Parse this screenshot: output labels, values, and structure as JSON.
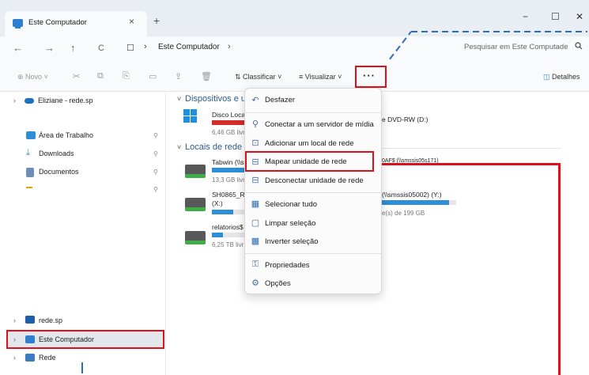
{
  "window": {
    "tab_title": "Este Computador",
    "tab_close": "×",
    "new_tab": "+",
    "minimize": "−",
    "maximize": "☐",
    "close": "✕"
  },
  "address": {
    "back": "←",
    "forward": "→",
    "up": "↑",
    "refresh": "C",
    "monitor_icon": "☐",
    "chevron": "›",
    "path": "Este Computador",
    "path_chevron": "›",
    "search_placeholder": "Pesquisar em Este Computade",
    "search_icon": "🔍"
  },
  "toolbar": {
    "new_label": "Novo",
    "cut": "✂",
    "copy": "⧉",
    "paste": "⎘",
    "rename": "▭",
    "share": "⇪",
    "delete": "🗑",
    "sort_label": "Classificar",
    "view_label": "Visualizar",
    "more": "···",
    "details_label": "Detalhes"
  },
  "nav": {
    "cloud_item": "Eliziane - rede.sp",
    "quick": [
      {
        "label": "Área de Trabalho"
      },
      {
        "label": "Downloads"
      },
      {
        "label": "Documentos"
      }
    ],
    "pin": "📌",
    "rede_sp": "rede.sp",
    "este_computador": "Este Computador",
    "rede": "Rede"
  },
  "content": {
    "section_devices": "Dispositivos e ur",
    "section_network": "Locais de rede",
    "drives": [
      {
        "name": "Disco Loca",
        "sub": "6,46 GB livr",
        "fill": 0.96,
        "color": "#d42b2b"
      },
      {
        "name": "Tabwin (\\\\s",
        "sub": "13,3 GB livr",
        "fill": 0.9,
        "color": "#2f8fd6"
      },
      {
        "name": "SH0865_RE",
        "name2": "(X:)",
        "sub": "",
        "fill": 0.6,
        "color": "#2f8fd6"
      },
      {
        "name": "relatorios$",
        "sub": "6,25 TB livr",
        "fill": 0.3,
        "color": "#2f8fd6"
      }
    ],
    "dvd_label": "e DVD-RW (D:)",
    "partial_top": "0AF$ (\\\\smssis05s171)",
    "smssis_label": "(\\\\smssis05002) (Y:)",
    "smssis_sub": "e(s) de 199 GB",
    "smssis_fill": 0.9
  },
  "menu": {
    "items": [
      {
        "icon": "↶",
        "label": "Desfazer"
      },
      {
        "icon": "⚲",
        "label": "Conectar a um servidor de mídia"
      },
      {
        "icon": "⊡",
        "label": "Adicionar um local de rede"
      },
      {
        "icon": "⊟",
        "label": "Mapear unidade de rede"
      },
      {
        "icon": "⊟",
        "label": "Desconectar unidade de rede"
      },
      {
        "icon": "▦",
        "label": "Selecionar tudo"
      },
      {
        "icon": "▢",
        "label": "Limpar seleção"
      },
      {
        "icon": "▩",
        "label": "Inverter seleção"
      },
      {
        "icon": "⚿",
        "label": "Propriedades"
      },
      {
        "icon": "⚙",
        "label": "Opções"
      }
    ]
  },
  "colors": {
    "accent": "#2f8fd6",
    "highlight": "#e0101a",
    "selected_nav": "#e3e6ea"
  }
}
